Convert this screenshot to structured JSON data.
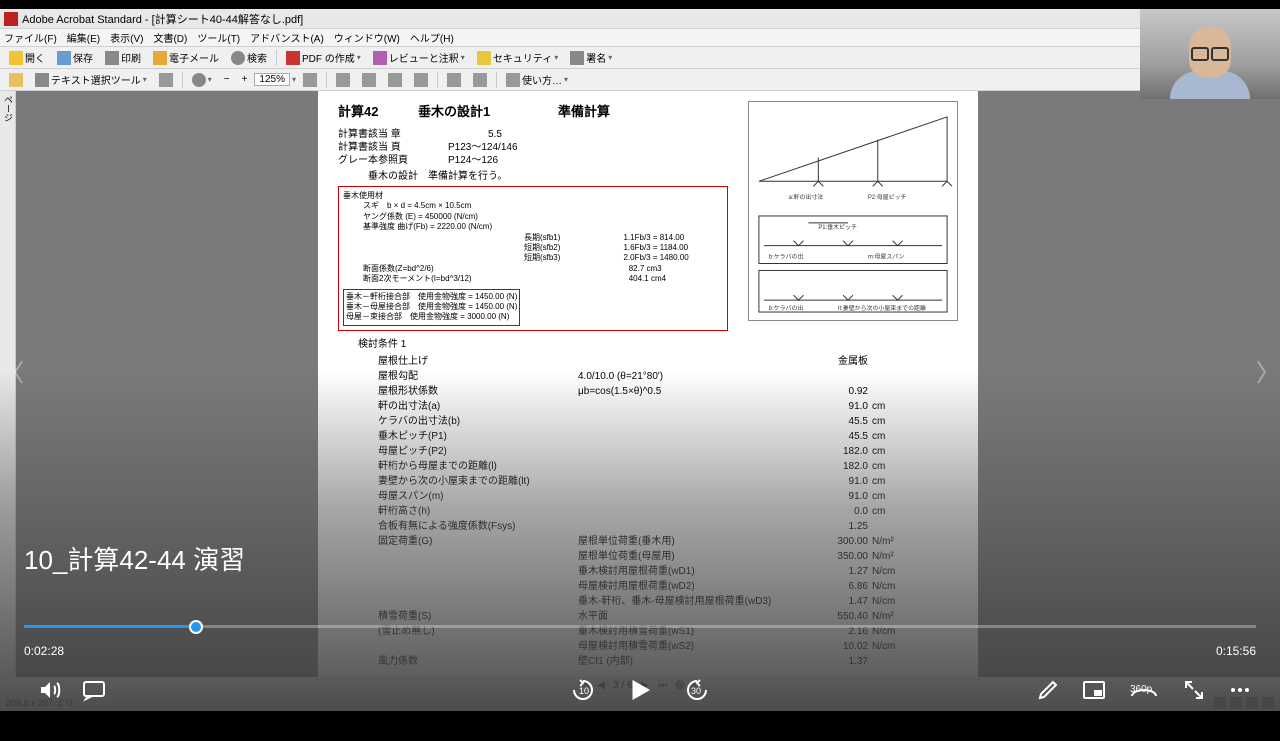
{
  "titlebar": {
    "title": "Adobe Acrobat Standard - [計算シート40-44解答なし.pdf]"
  },
  "menubar": {
    "file": "ファイル(F)",
    "edit": "編集(E)",
    "view": "表示(V)",
    "document": "文書(D)",
    "tools": "ツール(T)",
    "advanced": "アドバンスト(A)",
    "window": "ウィンドウ(W)",
    "help": "ヘルプ(H)"
  },
  "toolbar1": {
    "open": "開く",
    "save": "保存",
    "print": "印刷",
    "email": "電子メール",
    "search": "検索",
    "pdf": "PDF の作成",
    "review": "レビューと注釈",
    "security": "セキュリティ",
    "sign": "署名"
  },
  "toolbar2": {
    "select_tool": "テキスト選択ツール",
    "zoom": "125%",
    "howto": "使い方…"
  },
  "sidebar": {
    "tab": "ページ"
  },
  "doc": {
    "h1": "計算42",
    "h2": "垂木の設計1",
    "h3": "準備計算",
    "meta1_lbl": "計算書該当 章",
    "meta1_val": "5.5",
    "meta2_lbl": "計算書該当 頁",
    "meta2_val": "P123～124/146",
    "meta3_lbl": "グレー本参照頁",
    "meta3_val": "P124～126",
    "meta4": "垂木の設計　準備計算を行う。",
    "rb_title": "垂木使用材",
    "rb_sugi": "スギ　b × d = 4.5cm × 10.5cm",
    "rb_young": "ヤング係数 (E) = 450000 (N/cm)",
    "rb_base": "基準強度 曲げ(Fb) = 2220.00 (N/cm)",
    "rb_long": "長期(sfb1)",
    "rb_long_v": "1.1Fb/3 = 814.00",
    "rb_med": "短期(sfb2)",
    "rb_med_v": "1.6Fb/3 = 1184.00",
    "rb_short": "短期(sfb3)",
    "rb_short_v": "2.0Fb/3 = 1480.00",
    "rb_sect1": "断面係数(Z=bd^2/6)",
    "rb_sect1_v": "82.7 cm3",
    "rb_sect2": "断面2次モーメント(I=bd^3/12)",
    "rb_sect2_v": "404.1 cm4",
    "rb_j1": "垂木－軒桁接合部　使用金物強度 = 1450.00 (N)",
    "rb_j2": "垂木－母屋接合部　使用金物強度 = 1450.00 (N)",
    "rb_j3": "母屋－束接合部　使用金物強度 = 3000.00 (N)",
    "kentou": "検討条件 1",
    "params": [
      {
        "l": "屋根仕上げ",
        "m": "",
        "r": "金属板",
        "u": ""
      },
      {
        "l": "屋根勾配",
        "m": "4.0/10.0 (θ=21°80')",
        "r": "",
        "u": ""
      },
      {
        "l": "屋根形状係数",
        "m": "μb=cos(1.5×θ)^0.5",
        "r": "0.92",
        "u": ""
      },
      {
        "l": "軒の出寸法(a)",
        "m": "",
        "r": "91.0",
        "u": "cm"
      },
      {
        "l": "ケラバの出寸法(b)",
        "m": "",
        "r": "45.5",
        "u": "cm"
      },
      {
        "l": "垂木ピッチ(P1)",
        "m": "",
        "r": "45.5",
        "u": "cm"
      },
      {
        "l": "母屋ピッチ(P2)",
        "m": "",
        "r": "182.0",
        "u": "cm"
      },
      {
        "l": "軒桁から母屋までの距離(l)",
        "m": "",
        "r": "182.0",
        "u": "cm"
      },
      {
        "l": "妻壁から次の小屋束までの距離(lt)",
        "m": "",
        "r": "91.0",
        "u": "cm"
      },
      {
        "l": "母屋スパン(m)",
        "m": "",
        "r": "91.0",
        "u": "cm"
      },
      {
        "l": "軒桁高さ(h)",
        "m": "",
        "r": "0.0",
        "u": "cm"
      },
      {
        "l": "合板有無による強度係数(Fsys)",
        "m": "",
        "r": "1.25",
        "u": ""
      },
      {
        "l": "固定荷重(G)",
        "m": "屋根単位荷重(垂木用)",
        "r": "300.00",
        "u": "N/m²"
      },
      {
        "l": "",
        "m": "屋根単位荷重(母屋用)",
        "r": "350.00",
        "u": "N/m²"
      },
      {
        "l": "",
        "m": "垂木検討用屋根荷重(wD1)",
        "r": "1.27",
        "u": "N/cm"
      },
      {
        "l": "",
        "m": "母屋検討用屋根荷重(wD2)",
        "r": "6.86",
        "u": "N/cm"
      },
      {
        "l": "",
        "m": "垂木-軒桁、垂木-母屋検討用屋根荷重(wD3)",
        "r": "1.47",
        "u": "N/cm"
      },
      {
        "l": "積雪荷重(S)",
        "m": "水平面",
        "r": "550.40",
        "u": "N/m²"
      },
      {
        "l": "(雪止め無し)",
        "m": "垂木検討用積雪荷重(wS1)",
        "r": "2.16",
        "u": "N/cm"
      },
      {
        "l": "",
        "m": "母屋検討用積雪荷重(wS2)",
        "r": "10.02",
        "u": "N/cm"
      },
      {
        "l": "風力係数",
        "m": "壁Cf1 (内部)",
        "r": "1.37",
        "u": ""
      }
    ]
  },
  "pagenav": {
    "page": "3 / 6"
  },
  "statusbar": {
    "size": "209.9 x 297 ミリ"
  },
  "video": {
    "title": "10_計算42-44 演習",
    "time_current": "0:02:28",
    "time_total": "0:15:56",
    "skip_back": "10",
    "skip_fwd": "30",
    "quality": "360p"
  }
}
